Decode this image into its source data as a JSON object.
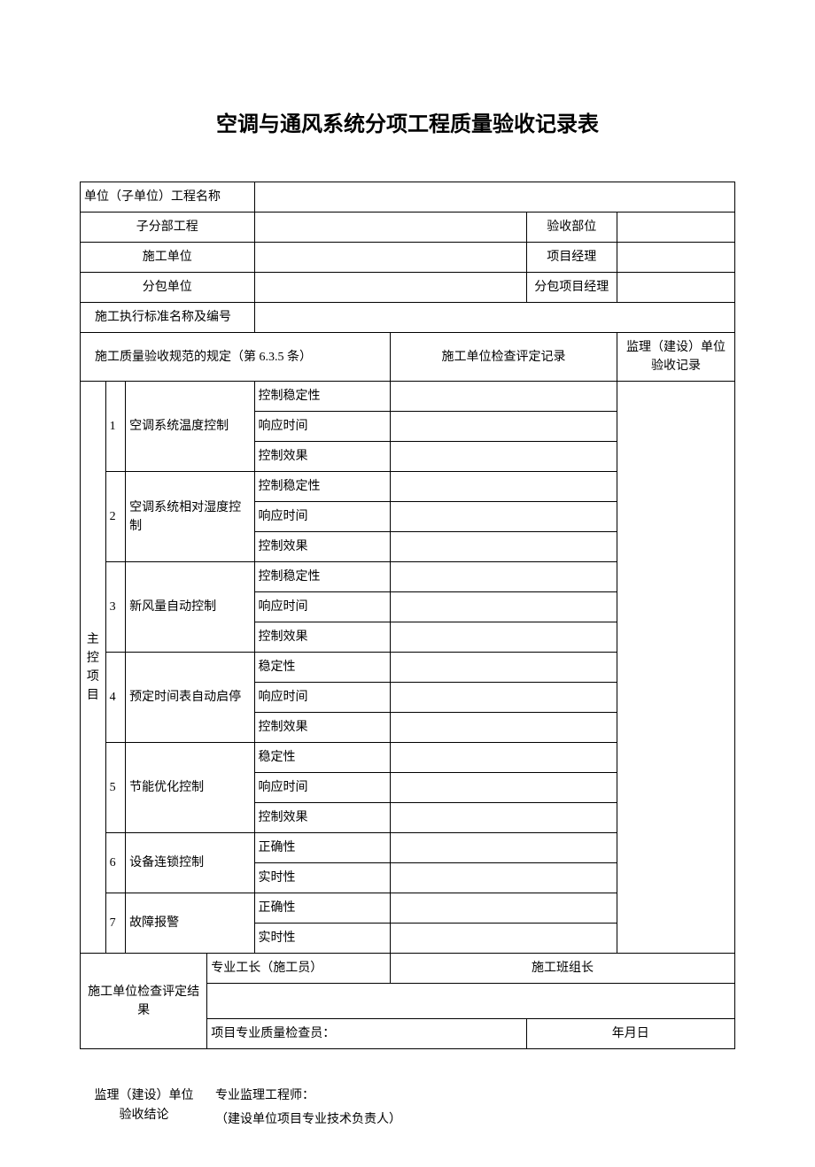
{
  "title": "空调与通风系统分项工程质量验收记录表",
  "header": {
    "unit_project_name": "单位（子单位）工程名称",
    "sub_division": "子分部工程",
    "acceptance_dept": "验收部位",
    "construction_unit": "施工单位",
    "project_manager": "项目经理",
    "subcontractor": "分包单位",
    "sub_project_manager": "分包项目经理",
    "standard_name_no": "施工执行标准名称及编号",
    "spec_rule": "施工质量验收规范的规定（第 6.3.5 条）",
    "check_record": "施工单位检查评定记录",
    "supervisor_record": "监理（建设）单位验收记录"
  },
  "main_group": "主控项目",
  "items": [
    {
      "no": "1",
      "name": "空调系统温度控制",
      "rows": [
        "控制稳定性",
        "响应时间",
        "控制效果"
      ]
    },
    {
      "no": "2",
      "name": "空调系统相对湿度控制",
      "rows": [
        "控制稳定性",
        "响应时间",
        "控制效果"
      ]
    },
    {
      "no": "3",
      "name": "新风量自动控制",
      "rows": [
        "控制稳定性",
        "响应时间",
        "控制效果"
      ]
    },
    {
      "no": "4",
      "name": "预定时间表自动启停",
      "rows": [
        "稳定性",
        "响应时间",
        "控制效果"
      ]
    },
    {
      "no": "5",
      "name": "节能优化控制",
      "rows": [
        "稳定性",
        "响应时间",
        "控制效果"
      ]
    },
    {
      "no": "6",
      "name": "设备连锁控制",
      "rows": [
        "正确性",
        "实时性"
      ]
    },
    {
      "no": "7",
      "name": "故障报警",
      "rows": [
        "正确性",
        "实时性"
      ]
    }
  ],
  "footer": {
    "check_result": "施工单位检查评定结果",
    "pro_foreman": "专业工长（施工员）",
    "team_leader": "施工班组长",
    "quality_inspector": "项目专业质量检查员：",
    "date": "年月日",
    "supervisor_conclusion_l1": "监理（建设）单位",
    "supervisor_conclusion_l2": "验收结论",
    "pro_engineer": "专业监理工程师：",
    "owner_tech": "（建设单位项目专业技术负责人）"
  }
}
